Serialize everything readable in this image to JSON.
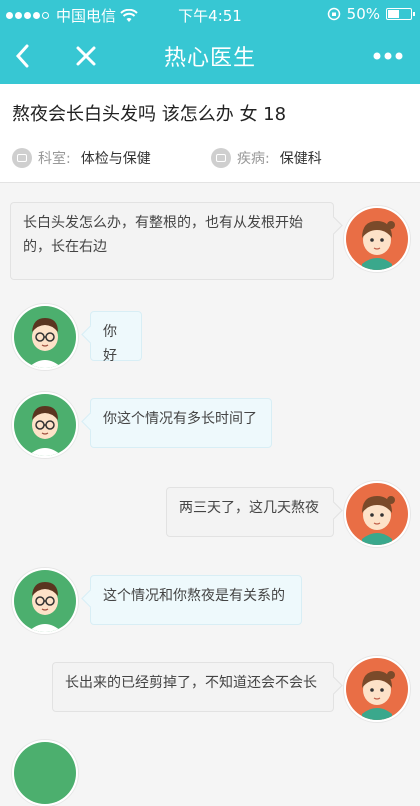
{
  "status_bar": {
    "carrier": "中国电信",
    "time": "下午4:51",
    "battery": "50%"
  },
  "nav": {
    "title": "热心医生"
  },
  "question": {
    "title": "熬夜会长白头发吗 该怎么办 女 18",
    "department_label": "科室:",
    "department": "体检与保健",
    "disease_label": "疾病:",
    "disease": "保健科"
  },
  "messages": [
    {
      "role": "patient",
      "text": "长白头发怎么办，有整根的，也有从发根开始的，长在右边"
    },
    {
      "role": "doctor",
      "text": "你好"
    },
    {
      "role": "doctor",
      "text": "你这个情况有多长时间了"
    },
    {
      "role": "patient",
      "text": "两三天了，这几天熬夜"
    },
    {
      "role": "doctor",
      "text": "这个情况和你熬夜是有关系的"
    },
    {
      "role": "patient",
      "text": "长出来的已经剪掉了，不知道还会不会长"
    }
  ]
}
